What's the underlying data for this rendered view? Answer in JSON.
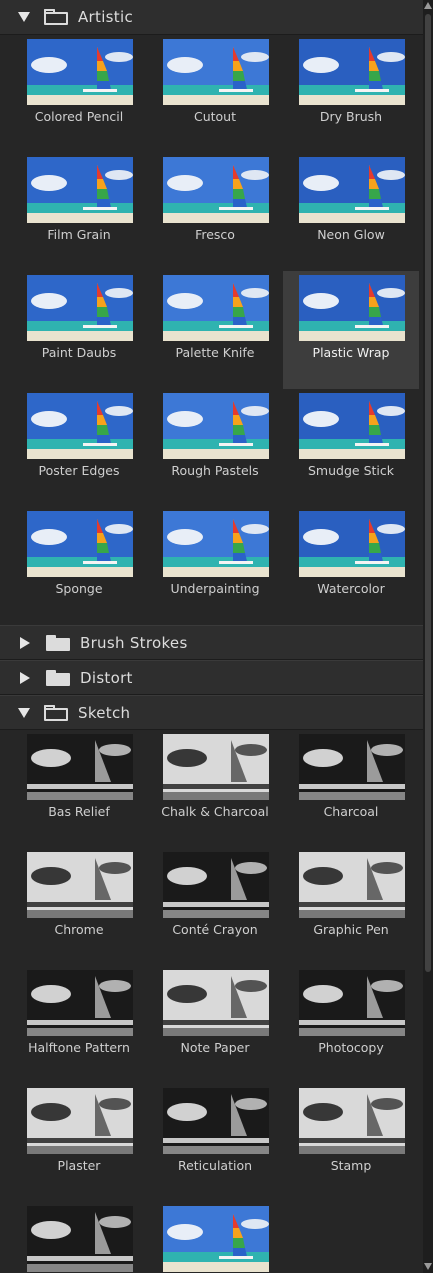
{
  "folders": [
    {
      "label": "Artistic",
      "expanded": true,
      "filters": [
        "Colored Pencil",
        "Cutout",
        "Dry Brush",
        "Film Grain",
        "Fresco",
        "Neon Glow",
        "Paint Daubs",
        "Palette Knife",
        "Plastic Wrap",
        "Poster Edges",
        "Rough Pastels",
        "Smudge Stick",
        "Sponge",
        "Underpainting",
        "Watercolor"
      ],
      "selected": "Plastic Wrap"
    },
    {
      "label": "Brush Strokes",
      "expanded": false
    },
    {
      "label": "Distort",
      "expanded": false
    },
    {
      "label": "Sketch",
      "expanded": true,
      "filters": [
        "Bas Relief",
        "Chalk & Charcoal",
        "Charcoal",
        "Chrome",
        "Conté Crayon",
        "Graphic Pen",
        "Halftone Pattern",
        "Note Paper",
        "Photocopy",
        "Plaster",
        "Reticulation",
        "Stamp",
        "",
        ""
      ]
    }
  ],
  "icons": {
    "expanded_arrow": "triangle-down-icon",
    "collapsed_arrow": "triangle-right-icon",
    "folder": "folder-icon",
    "folder_open": "folder-open-icon"
  },
  "colors": {
    "panel_bg": "#262626",
    "header_bg": "#2e2e2e",
    "selected_bg": "#3d3d3d",
    "text": "#d8d8d8"
  }
}
